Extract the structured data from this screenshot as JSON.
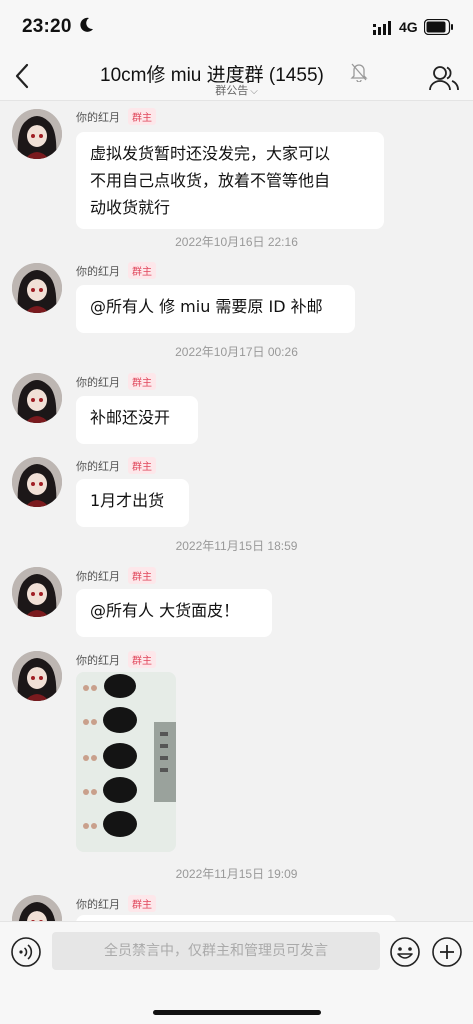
{
  "status_bar": {
    "time": "23:20",
    "network": "4G"
  },
  "header": {
    "title": "10cm修 miu 进度群 (1455)",
    "notice": "群公告",
    "icons": [
      "back-icon",
      "mute-bell-icon",
      "group-members-icon"
    ]
  },
  "messages": [
    {
      "sender": "你的红月",
      "badge": "群主",
      "lines": [
        "虚拟发货暂时还没发完，大家可以",
        "不用自己点收货，放着不管等他自",
        "动收货就行"
      ]
    },
    {
      "timestamp": "2022年10月16日 22:16"
    },
    {
      "sender": "你的红月",
      "badge": "群主",
      "text": "@所有人 修 miu 需要原 ID 补邮"
    },
    {
      "timestamp": "2022年10月17日 00:26"
    },
    {
      "sender": "你的红月",
      "badge": "群主",
      "text": "补邮还没开"
    },
    {
      "sender": "你的红月",
      "badge": "群主",
      "text": "1月才出货"
    },
    {
      "timestamp": "2022年11月15日 18:59"
    },
    {
      "sender": "你的红月",
      "badge": "群主",
      "text": "@所有人 大货面皮！"
    },
    {
      "sender": "你的红月",
      "badge": "群主",
      "image": "doll-faceplates-photo"
    },
    {
      "timestamp": "2022年11月15日 19:09"
    },
    {
      "sender": "你的红月",
      "badge": "群主"
    }
  ],
  "input_bar": {
    "placeholder": "全员禁言中，仅群主和管理员可发言",
    "icons": [
      "voice-icon",
      "emoji-icon",
      "plus-icon"
    ]
  }
}
